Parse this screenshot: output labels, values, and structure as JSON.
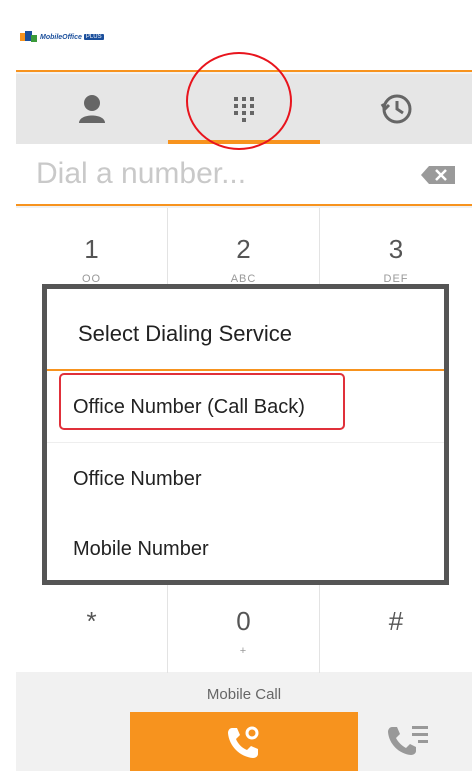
{
  "app": {
    "logo_text": "MobileOffice",
    "logo_badge": "PLUS"
  },
  "tabs": [
    {
      "icon": "contacts-icon",
      "active": false
    },
    {
      "icon": "dialpad-icon",
      "active": true
    },
    {
      "icon": "history-icon",
      "active": false
    }
  ],
  "dialer": {
    "placeholder": "Dial a number...",
    "value": ""
  },
  "keypad": [
    {
      "num": "1",
      "sub": "OO"
    },
    {
      "num": "2",
      "sub": "ABC"
    },
    {
      "num": "3",
      "sub": "DEF"
    },
    {
      "num": "*",
      "sub": ""
    },
    {
      "num": "0",
      "sub": "+"
    },
    {
      "num": "#",
      "sub": ""
    }
  ],
  "call": {
    "label": "Mobile Call"
  },
  "dialog": {
    "title": "Select Dialing Service",
    "options": [
      "Office Number (Call Back)",
      "Office Number",
      "Mobile Number"
    ]
  },
  "colors": {
    "accent": "#f7931e",
    "annotation": "#e8141d",
    "tab_bg": "#e6e6e6",
    "dialog_border": "#555555"
  }
}
